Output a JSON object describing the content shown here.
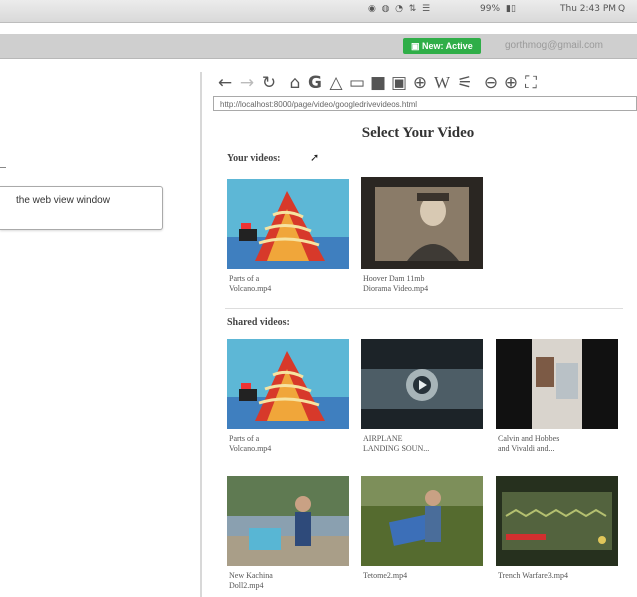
{
  "menubar": {
    "status_text": "Thu 2:43 PM",
    "battery": "99%"
  },
  "extension": {
    "badge": "New: Active",
    "email": "gorthmog@gmail.com"
  },
  "left_panel": {
    "tooltip": "the web view window"
  },
  "browser": {
    "url": "http://localhost:8000/page/video/googledrivevideos.html",
    "toolbar_icons": [
      "back-arrow-icon",
      "forward-arrow-icon",
      "reload-icon",
      "home-icon",
      "google-icon",
      "drive-icon",
      "monitor-icon",
      "camera-icon",
      "youtube-icon",
      "globe-icon",
      "wikipedia-icon",
      "broom-icon",
      "zoom-out-icon",
      "zoom-in-icon",
      "fullscreen-icon"
    ]
  },
  "page": {
    "title": "Select Your Video",
    "your_videos_heading": "Your videos:",
    "shared_videos_heading": "Shared videos:",
    "your_videos": [
      {
        "line1": "Parts of a",
        "line2": "Volcano.mp4"
      },
      {
        "line1": "Hoover Dam 11mb",
        "line2": "Diorama Video.mp4"
      }
    ],
    "shared_videos": [
      {
        "line1": "Parts of a",
        "line2": "Volcano.mp4"
      },
      {
        "line1": "AIRPLANE",
        "line2": "LANDING SOUN..."
      },
      {
        "line1": "Calvin and Hobbes",
        "line2": "and Vivaldi and..."
      },
      {
        "line1": "New Kachina",
        "line2": "Doll2.mp4"
      },
      {
        "line1": "Tetome2.mp4",
        "line2": ""
      },
      {
        "line1": "Trench Warfare3.mp4",
        "line2": ""
      }
    ]
  }
}
